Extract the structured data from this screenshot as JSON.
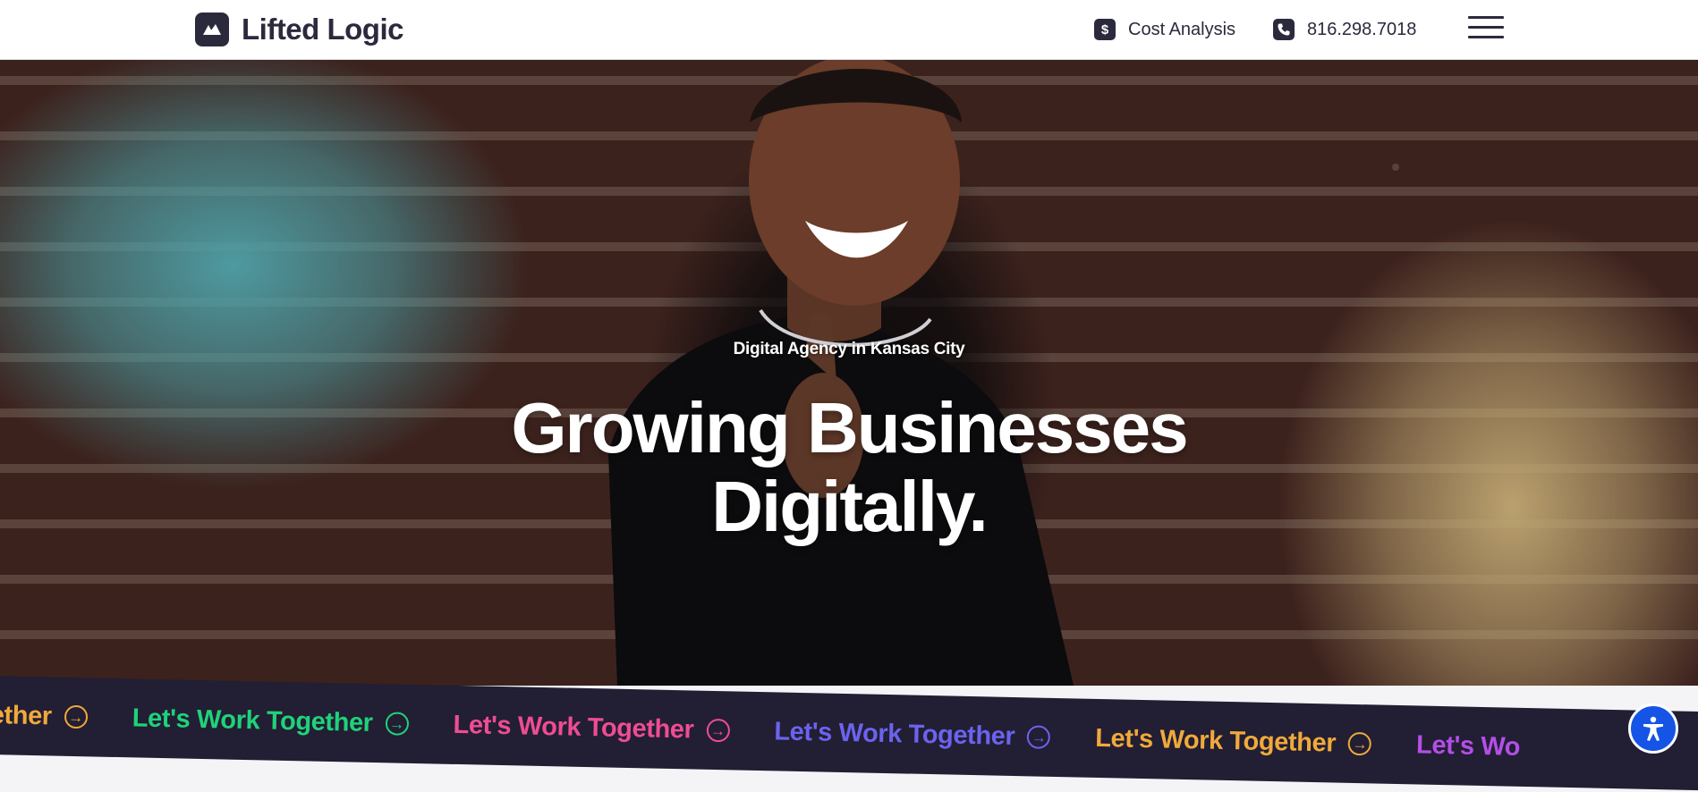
{
  "header": {
    "brand": "Lifted Logic",
    "cost_label": "Cost Analysis",
    "phone_label": "816.298.7018"
  },
  "hero": {
    "eyebrow": "Digital Agency in Kansas City",
    "headline_line1": "Growing Businesses",
    "headline_line2": "Digitally."
  },
  "marquee": {
    "items": [
      {
        "label": "Together",
        "color": "#f0a93b"
      },
      {
        "label": "Let's Work Together",
        "color": "#1fd27a"
      },
      {
        "label": "Let's Work Together",
        "color": "#ee4d93"
      },
      {
        "label": "Let's Work Together",
        "color": "#6b63ee"
      },
      {
        "label": "Let's Work Together",
        "color": "#f0a93b"
      },
      {
        "label": "Let's Wo",
        "color": "#b44ee8"
      }
    ]
  },
  "icons": {
    "logo": "logo-mark-icon",
    "cost": "dollar-icon",
    "phone": "phone-icon",
    "menu": "hamburger-menu-icon",
    "arrow": "arrow-right-circle-icon",
    "accessibility": "accessibility-icon"
  },
  "colors": {
    "brand_dark": "#2b2a3d",
    "band": "#221e33",
    "accessibility_blue": "#1554e5"
  }
}
